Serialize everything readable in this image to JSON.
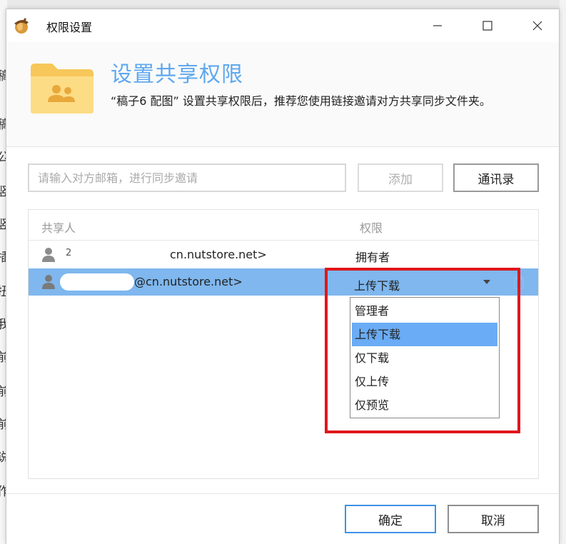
{
  "window": {
    "title": "权限设置",
    "icon": "acorn-icon",
    "controls": [
      "minimize-icon",
      "maximize-icon",
      "close-icon"
    ]
  },
  "header": {
    "title": "设置共享权限",
    "description": "“稿子6 配图” 设置共享权限后，推荐您使用链接邀请对方共享同步文件夹。"
  },
  "invite": {
    "email_placeholder": "请输入对方邮箱，进行同步邀请",
    "email_value": "",
    "add_label": "添加",
    "contacts_label": "通讯录"
  },
  "table": {
    "columns": [
      "共享人",
      "权限"
    ],
    "rows": [
      {
        "email": "cn.nutstore.net>",
        "prefix_mark": "2",
        "permission": "拥有者",
        "selected": false
      },
      {
        "email": "@cn.nutstore.net>",
        "permission": "上传下载",
        "selected": true
      }
    ]
  },
  "dropdown": {
    "options": [
      "管理者",
      "上传下载",
      "仅下载",
      "仅上传",
      "仅预览"
    ],
    "selected_index": 1
  },
  "footer": {
    "ok_label": "确定",
    "cancel_label": "取消"
  },
  "background_window_chars": [
    "稿",
    "稿",
    "公",
    "竖",
    "竖",
    "插",
    "扭",
    "我",
    "前",
    "前",
    "前",
    "说",
    "作"
  ],
  "colors": {
    "accent_title": "#5fa8ee",
    "row_selected": "#7fb7ee",
    "dropdown_selected": "#6aacf5",
    "highlight_box": "#e0161b",
    "ok_border": "#3f93e6"
  }
}
